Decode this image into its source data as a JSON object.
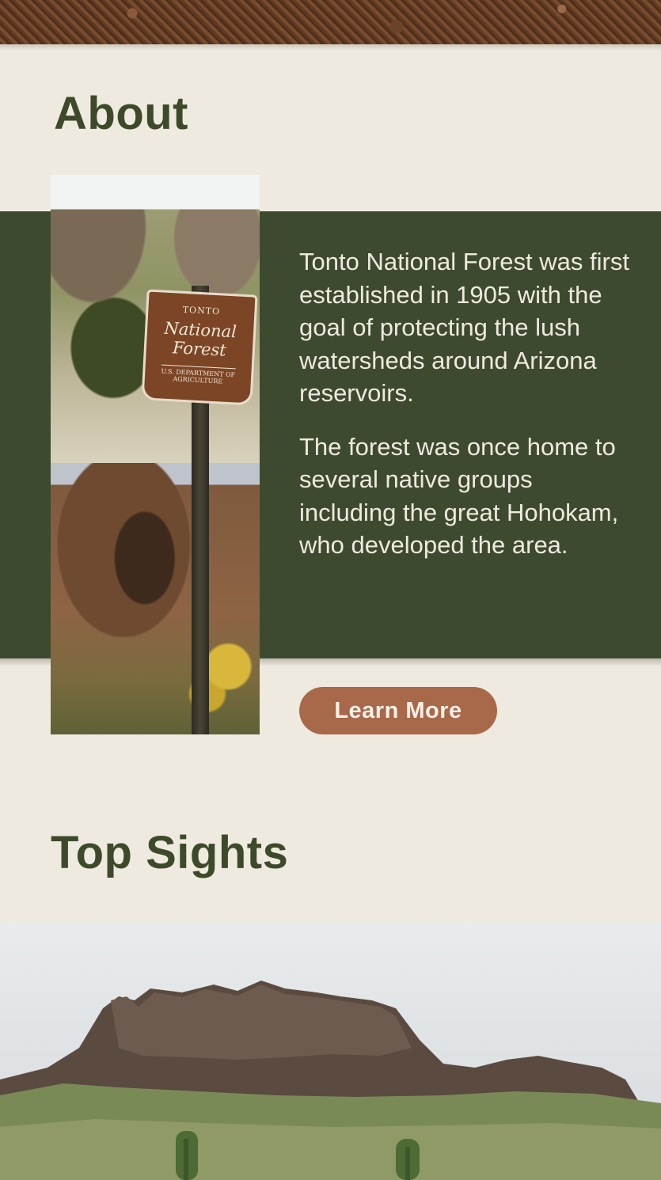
{
  "about": {
    "title": "About",
    "image_alt": "Tonto National Forest sign and cliff dwelling",
    "sign": {
      "line1": "TONTO",
      "line2": "National",
      "line3": "Forest",
      "line4": "U.S. DEPARTMENT OF AGRICULTURE"
    },
    "paragraphs": [
      "Tonto National Forest was first established in 1905 with the goal of protecting the lush watersheds around Arizona reservoirs.",
      "The forest was once home to several native groups including the great Hohokam, who developed the area."
    ],
    "button_label": "Learn More"
  },
  "top_sights": {
    "title": "Top Sights",
    "image_alt": "Superstition Mountains with saguaro cacti"
  },
  "colors": {
    "background": "#efeadf",
    "band_green": "#3d4a2f",
    "heading_green": "#3d4a2a",
    "button_brown": "#a8684a"
  }
}
